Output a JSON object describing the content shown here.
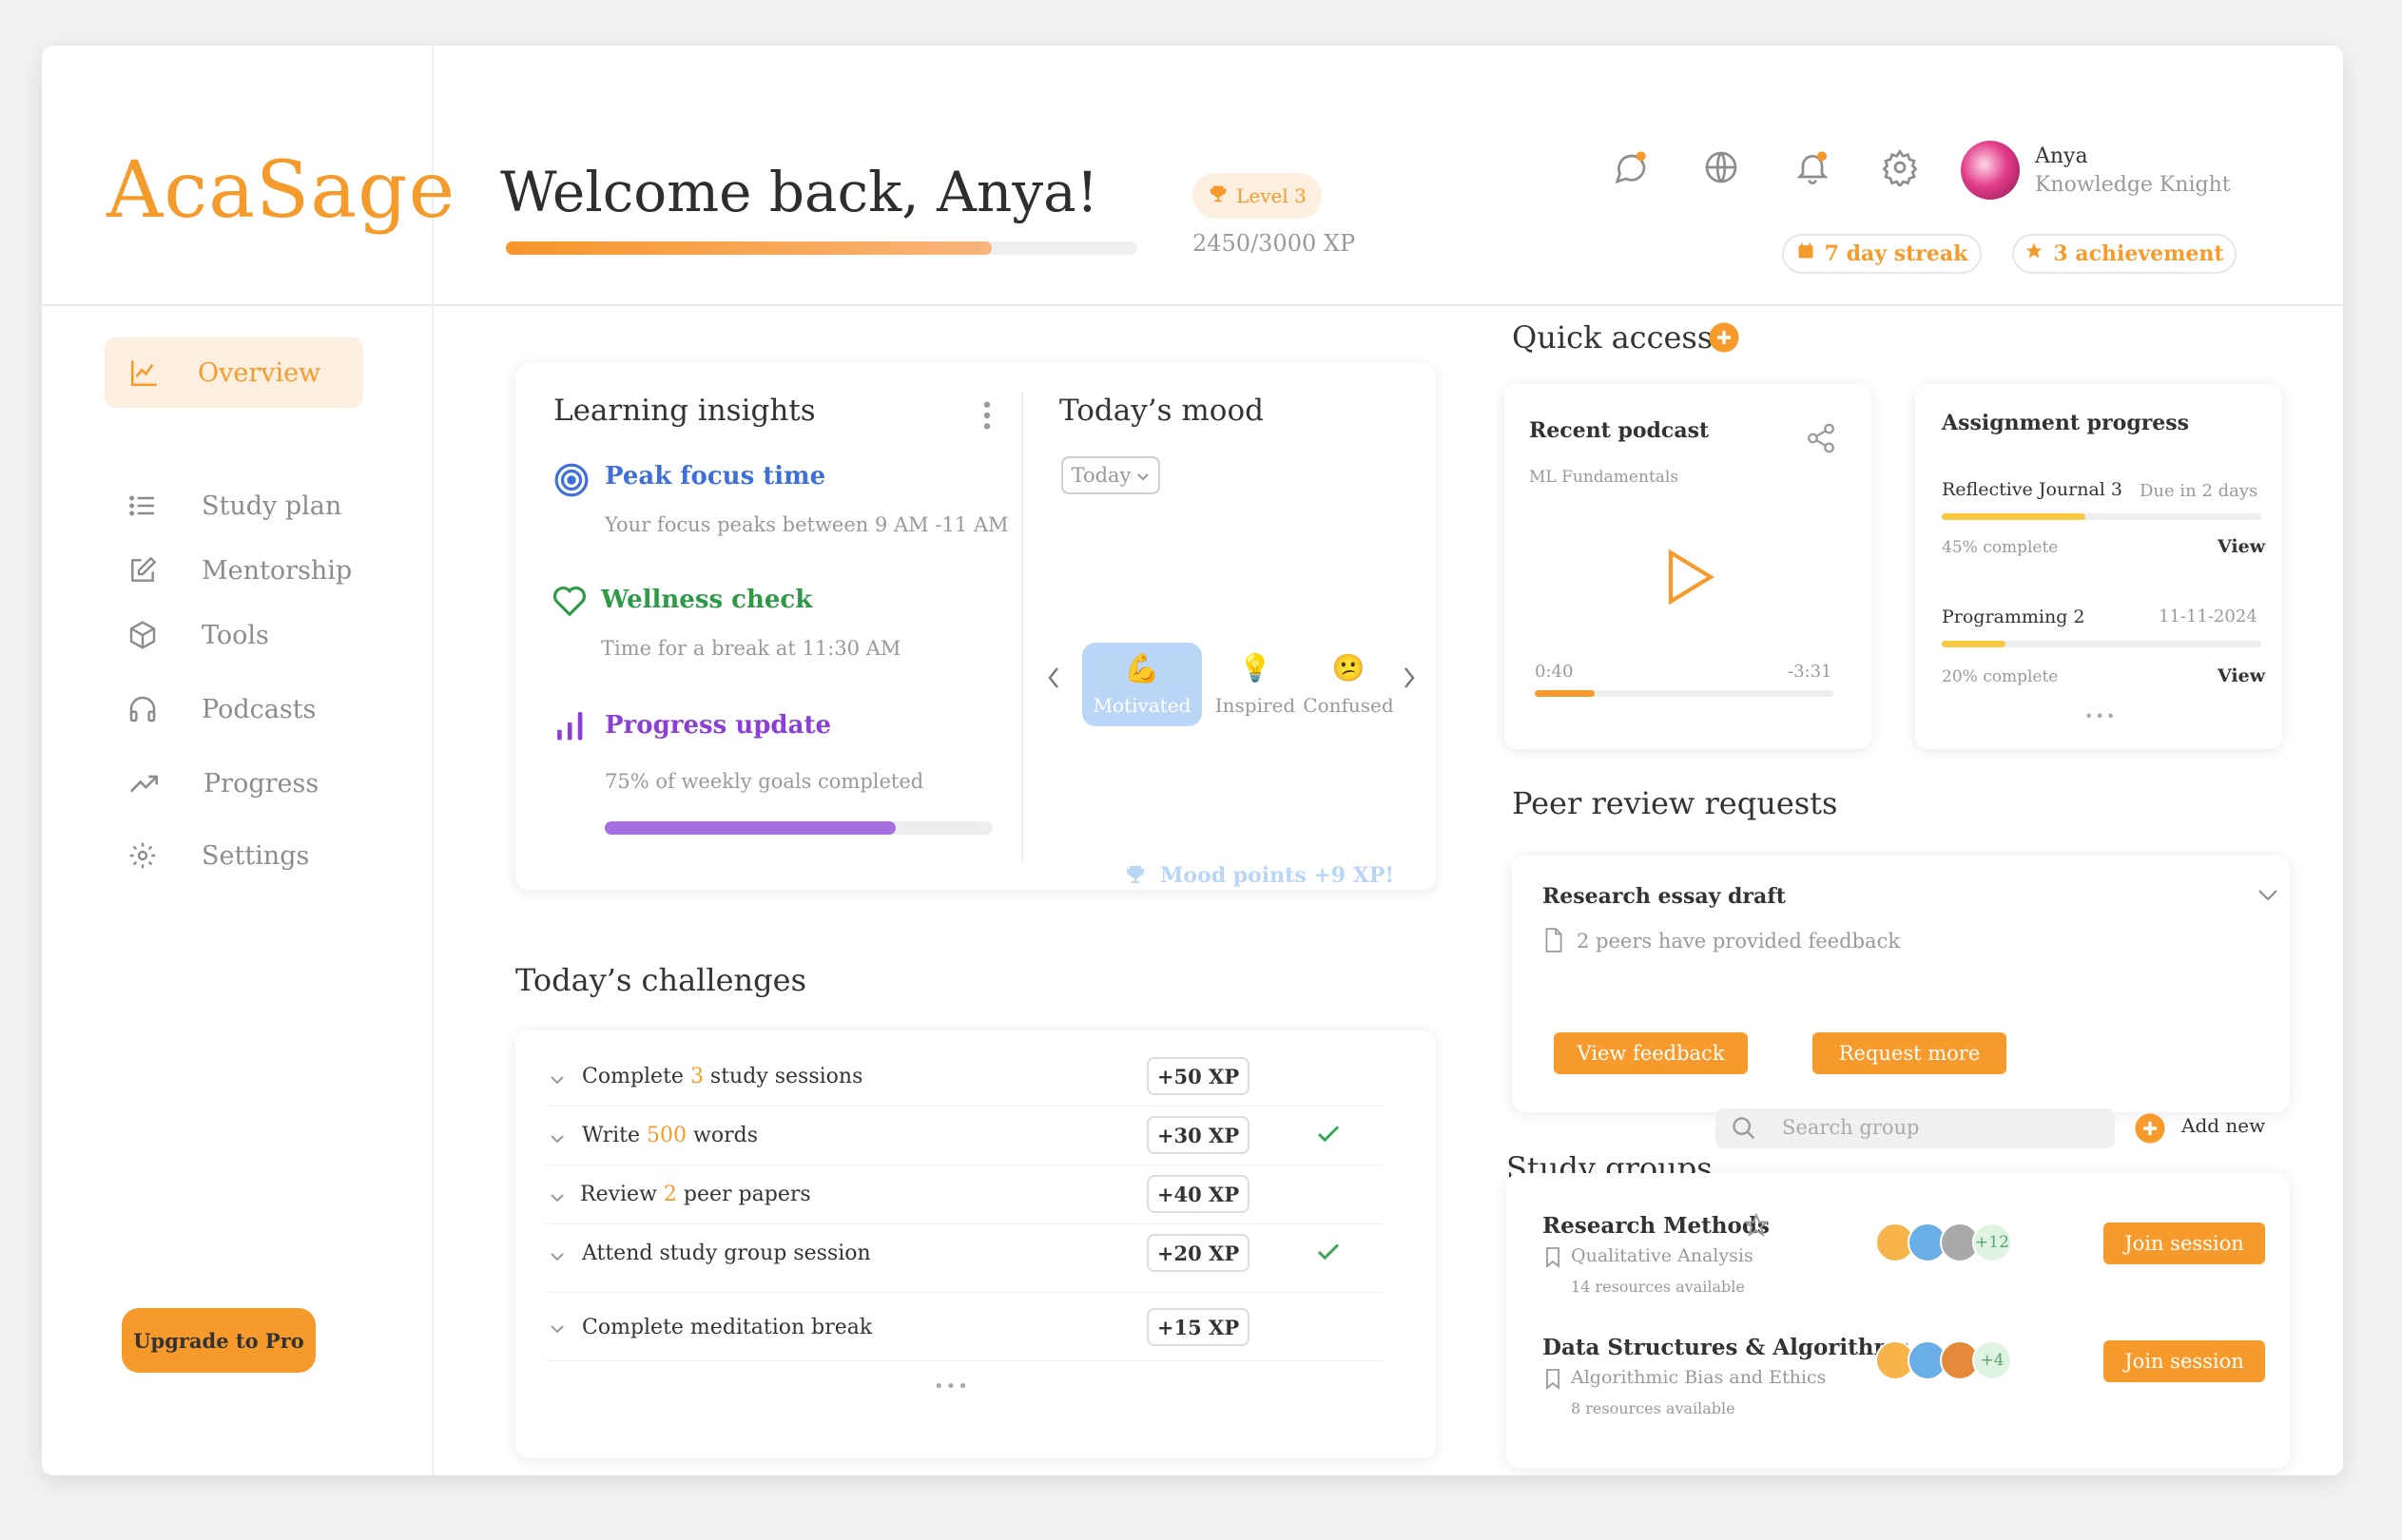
{
  "logo": "AcaSage",
  "nav": {
    "items": [
      {
        "label": "Overview",
        "icon": "chart-icon",
        "active": true
      },
      {
        "label": "Study plan",
        "icon": "list-icon"
      },
      {
        "label": "Mentorship",
        "icon": "edit-icon"
      },
      {
        "label": "Tools",
        "icon": "cube-icon"
      },
      {
        "label": "Podcasts",
        "icon": "headphones-icon"
      },
      {
        "label": "Progress",
        "icon": "trending-up-icon"
      },
      {
        "label": "Settings",
        "icon": "gear-icon"
      }
    ],
    "upgrade": "Upgrade to Pro"
  },
  "header": {
    "welcome": "Welcome back, Anya!",
    "level": "Level 3",
    "xp": "2450/3000 XP",
    "xp_progress": 0.77,
    "user": {
      "name": "Anya",
      "role": "Knowledge Knight"
    },
    "streak": "7 day streak",
    "achievements": "3 achievement"
  },
  "insights": {
    "title": "Learning insights",
    "peak": {
      "title": "Peak focus time",
      "desc": "Your focus peaks between 9 AM -11 AM"
    },
    "wellness": {
      "title": "Wellness check",
      "desc": "Time for a break at 11:30 AM"
    },
    "progress": {
      "title": "Progress update",
      "desc": "75% of weekly goals completed",
      "value": 0.75
    }
  },
  "mood": {
    "title": "Today’s mood",
    "select": "Today",
    "options": [
      {
        "emoji": "💪",
        "label": "Motivated"
      },
      {
        "emoji": "💡",
        "label": "Inspired"
      },
      {
        "emoji": "😕",
        "label": "Confused"
      }
    ],
    "points": "Mood points +9 XP!"
  },
  "challenges": {
    "title": "Today’s challenges",
    "items": [
      {
        "pre": "Complete ",
        "num": "3",
        "post": " study sessions",
        "xp": "+50 XP",
        "done": false
      },
      {
        "pre": "Write ",
        "num": "500",
        "post": " words",
        "xp": "+30 XP",
        "done": true
      },
      {
        "pre": "Review ",
        "num": "2",
        "post": " peer papers",
        "xp": "+40 XP",
        "done": false
      },
      {
        "pre": "Attend study group session",
        "num": "",
        "post": "",
        "xp": "+20 XP",
        "done": true
      },
      {
        "pre": "Complete meditation break",
        "num": "",
        "post": "",
        "xp": "+15 XP",
        "done": false
      }
    ],
    "more": "•••"
  },
  "quick": {
    "title": "Quick access",
    "podcast": {
      "title": "Recent podcast",
      "subtitle": "ML Fundamentals",
      "elapsed": "0:40",
      "remaining": "-3:31",
      "progress": 0.2
    },
    "assignments": {
      "title": "Assignment progress",
      "items": [
        {
          "name": "Reflective Journal 3",
          "due": "Due in 2 days",
          "complete": "45% complete",
          "progress": 0.45,
          "action": "View"
        },
        {
          "name": "Programming 2",
          "due": "11-11-2024",
          "complete": "20% complete",
          "progress": 0.2,
          "action": "View"
        }
      ],
      "more": "•••"
    }
  },
  "peer": {
    "title": "Peer review requests",
    "item": "Research essay draft",
    "feedback": "2 peers have provided feedback",
    "view": "View feedback",
    "request": "Request more"
  },
  "groups": {
    "title": "Study groups",
    "search_placeholder": "Search group",
    "add": "Add new",
    "items": [
      {
        "name": "Research Methods",
        "topic": "Qualitative Analysis",
        "resources": "14 resources available",
        "extra": "+12",
        "action": "Join session"
      },
      {
        "name": "Data Structures & Algorithms",
        "topic": "Algorithmic Bias and Ethics",
        "resources": "8 resources available",
        "extra": "+4",
        "action": "Join session"
      }
    ]
  },
  "colors": {
    "accent": "#f59b2b",
    "blue": "#3f6fd8",
    "green": "#2e9a48",
    "purple": "#8b3fd6"
  }
}
